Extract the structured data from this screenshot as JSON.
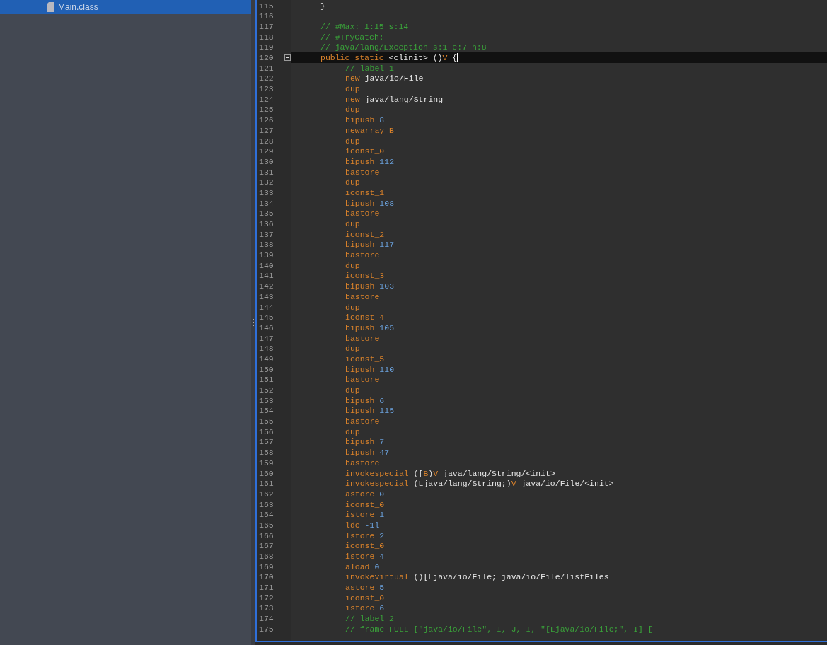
{
  "tree": {
    "items": [
      {
        "label": "Main.class",
        "selected": true
      }
    ]
  },
  "editor": {
    "lines": [
      {
        "no": "115",
        "current": false,
        "tokens": [
          {
            "kind": "plain",
            "t": "}"
          }
        ]
      },
      {
        "no": "116",
        "current": false
      },
      {
        "no": "117",
        "current": false,
        "tokens": [
          {
            "kind": "comment",
            "t": "// #Max: 1:15 s:14"
          }
        ]
      },
      {
        "no": "118",
        "current": false,
        "tokens": [
          {
            "kind": "comment",
            "t": "// #TryCatch:"
          }
        ]
      },
      {
        "no": "119",
        "current": false,
        "tokens": [
          {
            "kind": "comment",
            "t": "// java/lang/Exception s:1 e:7 h:8"
          }
        ]
      },
      {
        "no": "120",
        "current": true,
        "expanded": true,
        "tokens": [
          {
            "kind": "kw",
            "t": "public static"
          },
          {
            "kind": "plain",
            "t": " <clinit> ()"
          },
          {
            "kind": "kw",
            "t": "V"
          },
          {
            "kind": "plain",
            "t": " {"
          }
        ],
        "children": [
          {
            "no": "121",
            "current": false,
            "tokens": [
              {
                "kind": "comment",
                "t": "// label 1"
              }
            ]
          },
          {
            "no": "122",
            "current": false,
            "tokens": [
              {
                "kind": "kw",
                "t": "new"
              },
              {
                "kind": "plain",
                "t": " java/io/File"
              }
            ]
          },
          {
            "no": "123",
            "current": false,
            "tokens": [
              {
                "kind": "kw",
                "t": "dup"
              }
            ]
          },
          {
            "no": "124",
            "current": false,
            "tokens": [
              {
                "kind": "kw",
                "t": "new"
              },
              {
                "kind": "plain",
                "t": " java/lang/String"
              }
            ]
          },
          {
            "no": "125",
            "current": false,
            "tokens": [
              {
                "kind": "kw",
                "t": "dup"
              }
            ]
          },
          {
            "no": "126",
            "current": false,
            "tokens": [
              {
                "kind": "kw",
                "t": "bipush"
              },
              {
                "kind": "num",
                "t": " 8"
              }
            ]
          },
          {
            "no": "127",
            "current": false,
            "tokens": [
              {
                "kind": "kw",
                "t": "newarray B"
              }
            ]
          },
          {
            "no": "128",
            "current": false,
            "tokens": [
              {
                "kind": "kw",
                "t": "dup"
              }
            ]
          },
          {
            "no": "129",
            "current": false,
            "tokens": [
              {
                "kind": "kw",
                "t": "iconst_0"
              }
            ]
          },
          {
            "no": "130",
            "current": false,
            "tokens": [
              {
                "kind": "kw",
                "t": "bipush"
              },
              {
                "kind": "num",
                "t": " 112"
              }
            ]
          },
          {
            "no": "131",
            "current": false,
            "tokens": [
              {
                "kind": "kw",
                "t": "bastore"
              }
            ]
          },
          {
            "no": "132",
            "current": false,
            "tokens": [
              {
                "kind": "kw",
                "t": "dup"
              }
            ]
          },
          {
            "no": "133",
            "current": false,
            "tokens": [
              {
                "kind": "kw",
                "t": "iconst_1"
              }
            ]
          },
          {
            "no": "134",
            "current": false,
            "tokens": [
              {
                "kind": "kw",
                "t": "bipush"
              },
              {
                "kind": "num",
                "t": " 108"
              }
            ]
          },
          {
            "no": "135",
            "current": false,
            "tokens": [
              {
                "kind": "kw",
                "t": "bastore"
              }
            ]
          },
          {
            "no": "136",
            "current": false,
            "tokens": [
              {
                "kind": "kw",
                "t": "dup"
              }
            ]
          },
          {
            "no": "137",
            "current": false,
            "tokens": [
              {
                "kind": "kw",
                "t": "iconst_2"
              }
            ]
          },
          {
            "no": "138",
            "current": false,
            "tokens": [
              {
                "kind": "kw",
                "t": "bipush"
              },
              {
                "kind": "num",
                "t": " 117"
              }
            ]
          },
          {
            "no": "139",
            "current": false,
            "tokens": [
              {
                "kind": "kw",
                "t": "bastore"
              }
            ]
          },
          {
            "no": "140",
            "current": false,
            "tokens": [
              {
                "kind": "kw",
                "t": "dup"
              }
            ]
          },
          {
            "no": "141",
            "current": false,
            "tokens": [
              {
                "kind": "kw",
                "t": "iconst_3"
              }
            ]
          },
          {
            "no": "142",
            "current": false,
            "tokens": [
              {
                "kind": "kw",
                "t": "bipush"
              },
              {
                "kind": "num",
                "t": " 103"
              }
            ]
          },
          {
            "no": "143",
            "current": false,
            "tokens": [
              {
                "kind": "kw",
                "t": "bastore"
              }
            ]
          },
          {
            "no": "144",
            "current": false,
            "tokens": [
              {
                "kind": "kw",
                "t": "dup"
              }
            ]
          },
          {
            "no": "145",
            "current": false,
            "tokens": [
              {
                "kind": "kw",
                "t": "iconst_4"
              }
            ]
          },
          {
            "no": "146",
            "current": false,
            "tokens": [
              {
                "kind": "kw",
                "t": "bipush"
              },
              {
                "kind": "num",
                "t": " 105"
              }
            ]
          },
          {
            "no": "147",
            "current": false,
            "tokens": [
              {
                "kind": "kw",
                "t": "bastore"
              }
            ]
          },
          {
            "no": "148",
            "current": false,
            "tokens": [
              {
                "kind": "kw",
                "t": "dup"
              }
            ]
          },
          {
            "no": "149",
            "current": false,
            "tokens": [
              {
                "kind": "kw",
                "t": "iconst_5"
              }
            ]
          },
          {
            "no": "150",
            "current": false,
            "tokens": [
              {
                "kind": "kw",
                "t": "bipush"
              },
              {
                "kind": "num",
                "t": " 110"
              }
            ]
          },
          {
            "no": "151",
            "current": false,
            "tokens": [
              {
                "kind": "kw",
                "t": "bastore"
              }
            ]
          },
          {
            "no": "152",
            "current": false,
            "tokens": [
              {
                "kind": "kw",
                "t": "dup"
              }
            ]
          },
          {
            "no": "153",
            "current": false,
            "tokens": [
              {
                "kind": "kw",
                "t": "bipush"
              },
              {
                "kind": "num",
                "t": " 6"
              }
            ]
          },
          {
            "no": "154",
            "current": false,
            "tokens": [
              {
                "kind": "kw",
                "t": "bipush"
              },
              {
                "kind": "num",
                "t": " 115"
              }
            ]
          },
          {
            "no": "155",
            "current": false,
            "tokens": [
              {
                "kind": "kw",
                "t": "bastore"
              }
            ]
          },
          {
            "no": "156",
            "current": false,
            "tokens": [
              {
                "kind": "kw",
                "t": "dup"
              }
            ]
          },
          {
            "no": "157",
            "current": false,
            "tokens": [
              {
                "kind": "kw",
                "t": "bipush"
              },
              {
                "kind": "num",
                "t": " 7"
              }
            ]
          },
          {
            "no": "158",
            "current": false,
            "tokens": [
              {
                "kind": "kw",
                "t": "bipush"
              },
              {
                "kind": "num",
                "t": " 47"
              }
            ]
          },
          {
            "no": "159",
            "current": false,
            "tokens": [
              {
                "kind": "kw",
                "t": "bastore"
              }
            ]
          },
          {
            "no": "160",
            "current": false,
            "tokens": [
              {
                "kind": "kw",
                "t": "invokespecial"
              },
              {
                "kind": "plain",
                "t": " (["
              },
              {
                "kind": "kw",
                "t": "B"
              },
              {
                "kind": "plain",
                "t": ")"
              },
              {
                "kind": "kw",
                "t": "V"
              },
              {
                "kind": "plain",
                "t": " java/lang/String/<init>"
              }
            ]
          },
          {
            "no": "161",
            "current": false,
            "tokens": [
              {
                "kind": "kw",
                "t": "invokespecial"
              },
              {
                "kind": "plain",
                "t": " (Ljava/lang/String;)"
              },
              {
                "kind": "kw",
                "t": "V"
              },
              {
                "kind": "plain",
                "t": " java/io/File/<init>"
              }
            ]
          },
          {
            "no": "162",
            "current": false,
            "tokens": [
              {
                "kind": "kw",
                "t": "astore"
              },
              {
                "kind": "num",
                "t": " 0"
              }
            ]
          },
          {
            "no": "163",
            "current": false,
            "tokens": [
              {
                "kind": "kw",
                "t": "iconst_0"
              }
            ]
          },
          {
            "no": "164",
            "current": false,
            "tokens": [
              {
                "kind": "kw",
                "t": "istore"
              },
              {
                "kind": "num",
                "t": " 1"
              }
            ]
          },
          {
            "no": "165",
            "current": false,
            "tokens": [
              {
                "kind": "kw",
                "t": "ldc"
              },
              {
                "kind": "num",
                "t": " -1l"
              }
            ]
          },
          {
            "no": "166",
            "current": false,
            "tokens": [
              {
                "kind": "kw",
                "t": "lstore"
              },
              {
                "kind": "num",
                "t": " 2"
              }
            ]
          },
          {
            "no": "167",
            "current": false,
            "tokens": [
              {
                "kind": "kw",
                "t": "iconst_0"
              }
            ]
          },
          {
            "no": "168",
            "current": false,
            "tokens": [
              {
                "kind": "kw",
                "t": "istore"
              },
              {
                "kind": "num",
                "t": " 4"
              }
            ]
          },
          {
            "no": "169",
            "current": false,
            "tokens": [
              {
                "kind": "kw",
                "t": "aload"
              },
              {
                "kind": "num",
                "t": " 0"
              }
            ]
          },
          {
            "no": "170",
            "current": false,
            "tokens": [
              {
                "kind": "kw",
                "t": "invokevirtual"
              },
              {
                "kind": "plain",
                "t": " ()[Ljava/io/File; java/io/File/listFiles"
              }
            ]
          },
          {
            "no": "171",
            "current": false,
            "tokens": [
              {
                "kind": "kw",
                "t": "astore"
              },
              {
                "kind": "num",
                "t": " 5"
              }
            ]
          },
          {
            "no": "172",
            "current": false,
            "tokens": [
              {
                "kind": "kw",
                "t": "iconst_0"
              }
            ]
          },
          {
            "no": "173",
            "current": false,
            "tokens": [
              {
                "kind": "kw",
                "t": "istore"
              },
              {
                "kind": "num",
                "t": " 6"
              }
            ]
          },
          {
            "no": "174",
            "current": false,
            "tokens": [
              {
                "kind": "comment",
                "t": "// label 2"
              }
            ]
          },
          {
            "no": "175",
            "current": false,
            "tokens": [
              {
                "kind": "comment",
                "t": "// frame FULL [\"java/io/File\", I, J, I, \"[Ljava/io/File;\", I] ["
              }
            ]
          }
        ]
      }
    ]
  }
}
